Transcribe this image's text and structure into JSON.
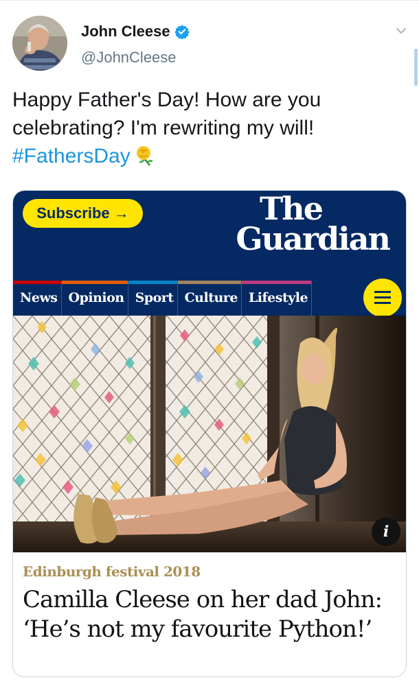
{
  "tweet": {
    "author_name": "John Cleese",
    "handle": "@JohnCleese",
    "text_before": "Happy Father's Day! How are you celebrating? I'm rewriting my will! ",
    "hashtag": "#FathersDay",
    "emoji_icon": "yellow-rose-icon",
    "verified_icon": "verified-badge-icon",
    "menu_icon": "chevron-down-icon"
  },
  "card": {
    "subscribe_label": "Subscribe →",
    "logo_line1": "The",
    "logo_line2": "Guardian",
    "nav": [
      {
        "label": "News",
        "color": "#c70000"
      },
      {
        "label": "Opinion",
        "color": "#e05e00"
      },
      {
        "label": "Sport",
        "color": "#0084c6"
      },
      {
        "label": "Culture",
        "color": "#a1845c"
      },
      {
        "label": "Lifestyle",
        "color": "#bb3b80"
      }
    ],
    "menu_icon": "hamburger-menu-icon",
    "info_label": "i",
    "kicker": "Edinburgh festival 2018",
    "headline": "Camilla Cleese on her dad John: ‘He’s not my favourite Python!’"
  },
  "colors": {
    "hashtag": "#1b95e0",
    "guardian_blue": "#052962",
    "guardian_yellow": "#ffe500",
    "kicker": "#ab8f55"
  }
}
